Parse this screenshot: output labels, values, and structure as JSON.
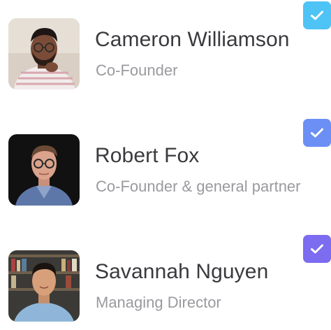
{
  "team": [
    {
      "name": "Cameron Williamson",
      "role": "Co-Founder",
      "avatar_icon": "person-photo-striped-shirt",
      "checked": true,
      "check_color": "#4ec3f5"
    },
    {
      "name": "Robert Fox",
      "role": "Co-Founder & general partner",
      "avatar_icon": "person-photo-dark-background",
      "checked": true,
      "check_color": "#6b8ff5"
    },
    {
      "name": "Savannah Nguyen",
      "role": "Managing Director",
      "avatar_icon": "person-photo-bookshelf",
      "checked": true,
      "check_color": "#7b6cf0"
    }
  ]
}
